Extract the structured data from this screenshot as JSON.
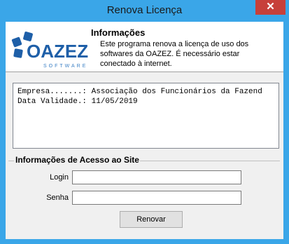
{
  "window": {
    "title": "Renova Licença",
    "close_label": "✕"
  },
  "header": {
    "logo_text": "OAZEZ",
    "logo_sub": "SOFTWARE",
    "title": "Informações",
    "description": "Este programa renova a licença de uso dos softwares da OAZEZ. É necessário estar conectado à internet."
  },
  "memo": {
    "line1": "Empresa.......: Associação dos Funcionários da Fazend",
    "line2": "Data Validade.: 11/05/2019"
  },
  "access": {
    "group_title": "Informações de Acesso ao Site",
    "login_label": "Login",
    "login_value": "",
    "password_label": "Senha",
    "password_value": "",
    "renew_button": "Renovar"
  },
  "colors": {
    "frame": "#3aa6e8",
    "close": "#c7403a",
    "logo_blue": "#1e5fa8"
  }
}
